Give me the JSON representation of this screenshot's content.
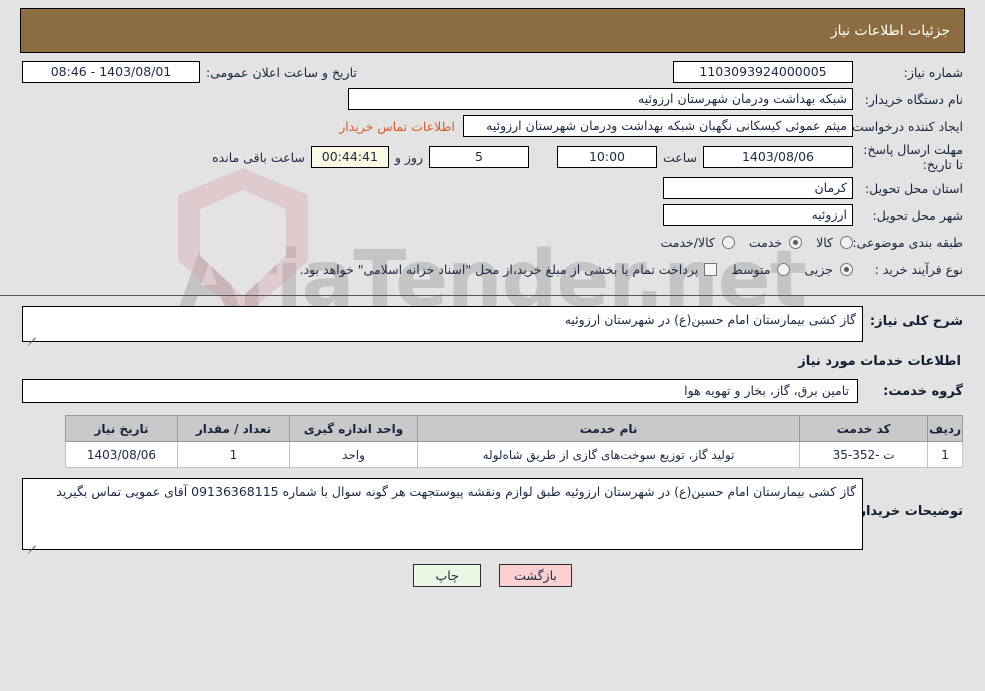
{
  "header": {
    "title": "جزئیات اطلاعات نیاز"
  },
  "form": {
    "need_number_label": "شماره نیاز:",
    "need_number_value": "1103093924000005",
    "public_announce_label": "تاریخ و ساعت اعلان عمومی:",
    "public_announce_value": "1403/08/01 - 08:46",
    "buyer_org_label": "نام دستگاه خریدار:",
    "buyer_org_value": "شبکه بهداشت ودرمان شهرستان ارزوئیه",
    "creator_label": "ایجاد کننده درخواست:",
    "creator_value": "میثم عموئی کیسکانی نگهبان شبکه بهداشت ودرمان شهرستان ارزوئیه",
    "contact_link": "اطلاعات تماس خریدار",
    "deadline_label": "مهلت ارسال پاسخ: تا تاریخ:",
    "deadline_date": "1403/08/06",
    "hour_word": "ساعت",
    "deadline_time": "10:00",
    "days_value": "5",
    "days_word": "روز و",
    "remaining_time": "00:44:41",
    "remaining_word": "ساعت باقی مانده",
    "province_label": "استان محل تحویل:",
    "province_value": "کرمان",
    "city_label": "شهر محل تحویل:",
    "city_value": "ارزوئیه",
    "category_label": "طبقه بندی موضوعی:",
    "category_options": [
      "کالا",
      "خدمت",
      "کالا/خدمت"
    ],
    "category_selected": "خدمت",
    "purchase_type_label": "نوع فرآیند خرید :",
    "purchase_type_options": [
      "جزیی",
      "متوسط"
    ],
    "purchase_type_selected": "جزیی",
    "treasury_note": "پرداخت تمام یا بخشی از مبلغ خرید،از محل \"اسناد خزانه اسلامی\" خواهد بود.",
    "treasury_checked": false
  },
  "details": {
    "general_desc_label": "شرح کلی نیاز:",
    "general_desc_value": "گاز کشی بیمارستان امام حسین(ع) در شهرستان ارزوئیه",
    "services_section_title": "اطلاعات خدمات مورد نیاز",
    "service_group_label": "گروه خدمت:",
    "service_group_value": "تامین برق، گاز، بخار و تهویه هوا"
  },
  "table": {
    "columns": [
      "ردیف",
      "کد خدمت",
      "نام خدمت",
      "واحد اندازه گیری",
      "تعداد / مقدار",
      "تاریخ نیاز"
    ],
    "rows": [
      {
        "radif": "1",
        "code": "ت -352-35",
        "name": "تولید گاز، توزیع سوخت‌های گازی از طریق شاه‌لوله",
        "unit": "واحد",
        "qty": "1",
        "date": "1403/08/06"
      }
    ]
  },
  "notes": {
    "label": "توضیحات خریدار:",
    "value": "گاز کشی بیمارستان امام حسین(ع) در شهرستان ارزوئیه طبق لوازم ونقشه پیوستجهت هر گونه سوال با شماره 09136368115 آقای عمویی تماس بگیرید"
  },
  "footer": {
    "back_label": "بازگشت",
    "print_label": "چاپ"
  },
  "watermark": {
    "text": "AriaTender.net"
  },
  "colors": {
    "header_bg": "#8c6d41",
    "page_bg": "#e3e3e3",
    "link": "#e2592c",
    "back_btn": "#fbd0d0",
    "print_btn": "#e9f7e4",
    "table_header": "#c9c9c9"
  }
}
